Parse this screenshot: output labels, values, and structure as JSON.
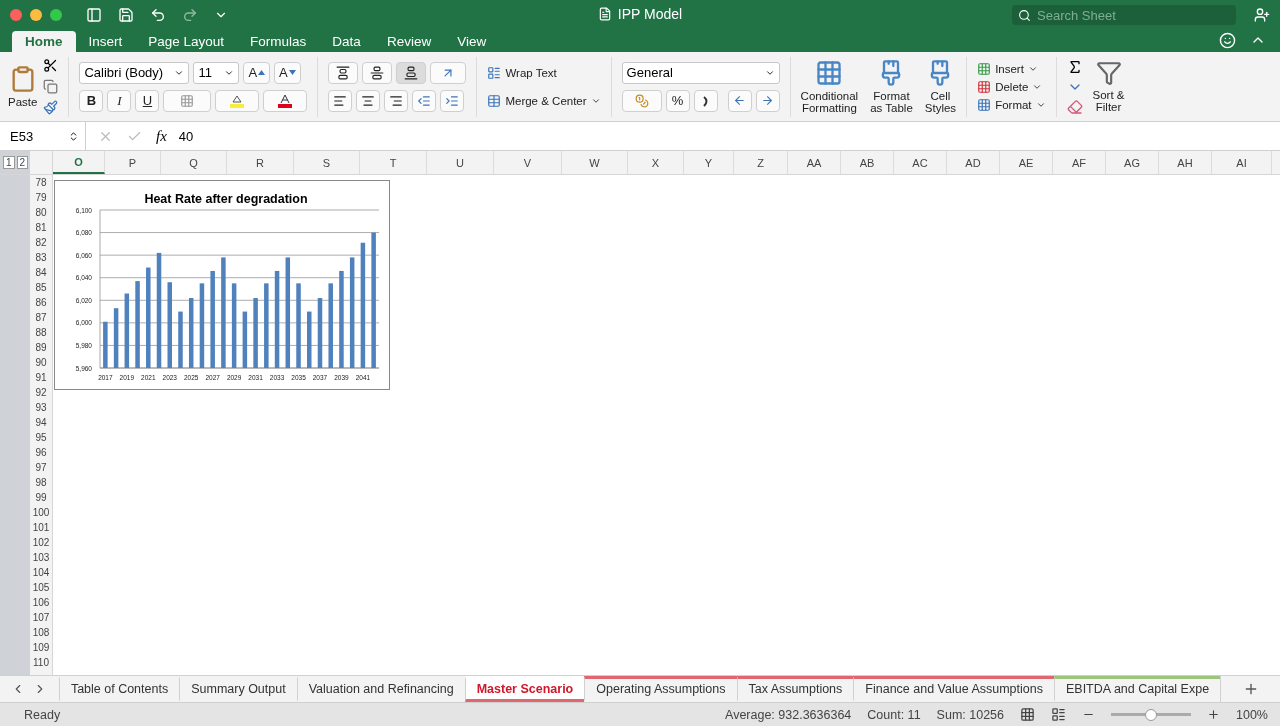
{
  "window": {
    "title": "IPP Model",
    "search_placeholder": "Search Sheet"
  },
  "ribbon_tabs": [
    {
      "label": "Home",
      "selected": true
    },
    {
      "label": "Insert",
      "selected": false
    },
    {
      "label": "Page Layout",
      "selected": false
    },
    {
      "label": "Formulas",
      "selected": false
    },
    {
      "label": "Data",
      "selected": false
    },
    {
      "label": "Review",
      "selected": false
    },
    {
      "label": "View",
      "selected": false
    }
  ],
  "ribbon": {
    "paste": "Paste",
    "grow_font": "A",
    "shrink_font": "A",
    "font_name": "Calibri (Body)",
    "font_size": "11",
    "bold": "B",
    "italic": "I",
    "underline": "U",
    "wrap_text": "Wrap Text",
    "merge_center": "Merge & Center",
    "number_format": "General",
    "percent": "%",
    "styles": [
      "Conditional\nFormatting",
      "Format\nas Table",
      "Cell\nStyles"
    ],
    "cells": [
      "Insert",
      "Delete",
      "Format"
    ],
    "sort_filter": "Sort &\nFilter"
  },
  "formula_bar": {
    "cell_ref": "E53",
    "function_label": "fx",
    "value": "40"
  },
  "columns": [
    {
      "label": "O",
      "selected": true
    },
    {
      "label": "P",
      "selected": false
    },
    {
      "label": "Q",
      "selected": false
    },
    {
      "label": "R",
      "selected": false
    },
    {
      "label": "S",
      "selected": false
    },
    {
      "label": "T",
      "selected": false
    },
    {
      "label": "U",
      "selected": false
    },
    {
      "label": "V",
      "selected": false
    },
    {
      "label": "W",
      "selected": false
    },
    {
      "label": "X",
      "selected": false
    },
    {
      "label": "Y",
      "selected": false
    },
    {
      "label": "Z",
      "selected": false
    },
    {
      "label": "AA",
      "selected": false
    },
    {
      "label": "AB",
      "selected": false
    },
    {
      "label": "AC",
      "selected": false
    },
    {
      "label": "AD",
      "selected": false
    },
    {
      "label": "AE",
      "selected": false
    },
    {
      "label": "AF",
      "selected": false
    },
    {
      "label": "AG",
      "selected": false
    },
    {
      "label": "AH",
      "selected": false
    },
    {
      "label": "AI",
      "selected": false
    }
  ],
  "outline_levels": [
    "1",
    "2"
  ],
  "rows": [
    "78",
    "79",
    "80",
    "81",
    "82",
    "83",
    "84",
    "85",
    "86",
    "87",
    "88",
    "89",
    "90",
    "91",
    "92",
    "93",
    "94",
    "95",
    "96",
    "97",
    "98",
    "99",
    "100",
    "101",
    "102",
    "103",
    "104",
    "105",
    "106",
    "107",
    "108",
    "109",
    "110"
  ],
  "chart": {
    "chart_data": {
      "type": "bar",
      "title": "Heat Rate after degradation",
      "x": [
        2017,
        2018,
        2019,
        2020,
        2021,
        2022,
        2023,
        2024,
        2025,
        2026,
        2027,
        2028,
        2029,
        2030,
        2031,
        2032,
        2033,
        2034,
        2035,
        2036,
        2037,
        2038,
        2039,
        2040,
        2041,
        2042
      ],
      "grid": true,
      "series": [
        {
          "color": "#4f81bd",
          "values": [
            6001,
            6013,
            6026,
            6037,
            6049,
            6062,
            6036,
            6010,
            6022,
            6035,
            6046,
            6058,
            6035,
            6010,
            6022,
            6035,
            6046,
            6058,
            6035,
            6010,
            6022,
            6035,
            6046,
            6058,
            6071,
            6080
          ]
        }
      ],
      "xlim": [
        2016.5,
        2042.5
      ],
      "ylim": [
        5960,
        6100
      ],
      "yticks": [
        {
          "value": 5960,
          "label": "5,960"
        },
        {
          "value": 5980,
          "label": "5,980"
        },
        {
          "value": 6000,
          "label": "6,000"
        },
        {
          "value": 6020,
          "label": "6,020"
        },
        {
          "value": 6040,
          "label": "6,040"
        },
        {
          "value": 6060,
          "label": "6,060"
        },
        {
          "value": 6080,
          "label": "6,080"
        },
        {
          "value": 6100,
          "label": "6,100"
        }
      ],
      "xticks": [
        2017,
        2019,
        2021,
        2023,
        2025,
        2027,
        2029,
        2031,
        2033,
        2035,
        2037,
        2039,
        2041
      ]
    }
  },
  "sheet_tabs": [
    {
      "label": "Table of Contents",
      "selected": false
    },
    {
      "label": "Summary Output",
      "selected": false
    },
    {
      "label": "Valuation and Refinancing",
      "selected": false
    },
    {
      "label": "Master Scenario",
      "selected": true,
      "color": "#e06670"
    },
    {
      "label": "Operating Assumptions",
      "selected": false,
      "color": "#e06670"
    },
    {
      "label": "Tax Assumptions",
      "selected": false,
      "color": "#e06670"
    },
    {
      "label": "Finance and Value Assumptions",
      "selected": false,
      "color": "#e06670"
    },
    {
      "label": "EBITDA and Capital Expe",
      "selected": false,
      "color": "#9bc47d"
    }
  ],
  "status_bar": {
    "state": "Ready",
    "average": "Average: 932.3636364",
    "count": "Count: 11",
    "sum": "Sum: 10256",
    "zoom": "100%",
    "zoom_level": {
      "level": 0.5
    }
  }
}
